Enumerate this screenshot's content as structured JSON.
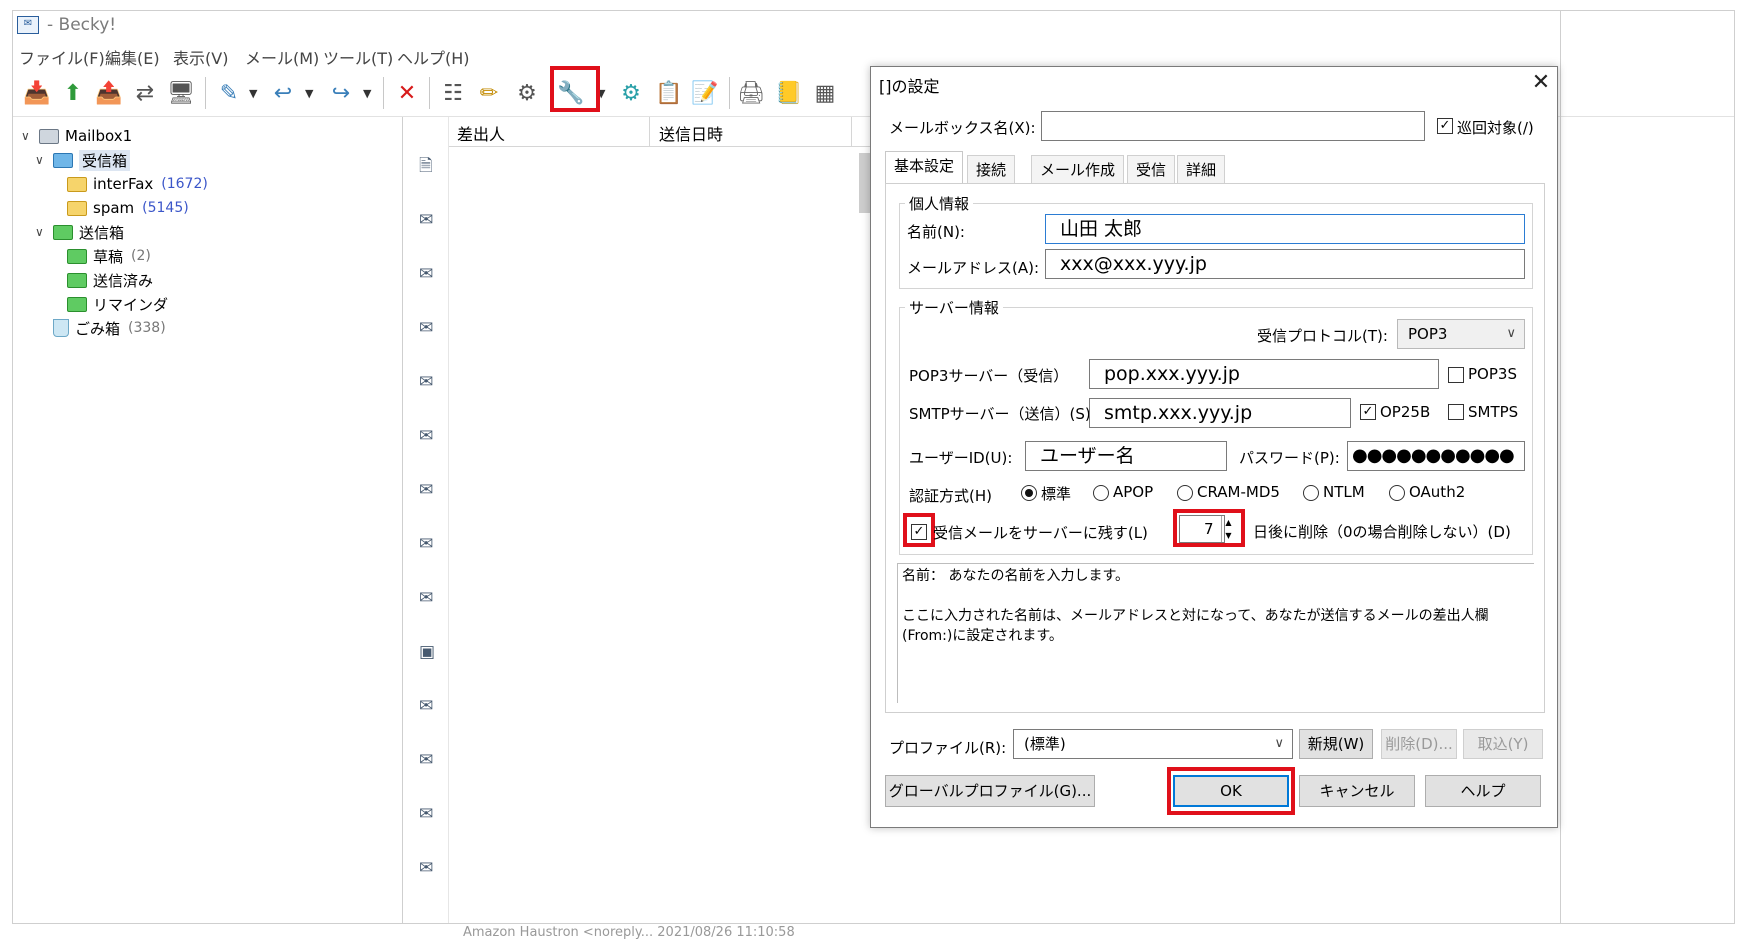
{
  "app": {
    "title": "- Becky!"
  },
  "menu": [
    "ファイル(F)",
    "編集(E)",
    "表示(V)",
    "メール(M)",
    "ツール(T)",
    "ヘルプ(H)"
  ],
  "folders": [
    {
      "label": "Mailbox1",
      "count": ""
    },
    {
      "label": "受信箱",
      "count": ""
    },
    {
      "label": "interFax",
      "count": "(1672)"
    },
    {
      "label": "spam",
      "count": "(5145)"
    },
    {
      "label": "送信箱",
      "count": ""
    },
    {
      "label": "草稿",
      "count": "(2)"
    },
    {
      "label": "送信済み",
      "count": ""
    },
    {
      "label": "リマインダ",
      "count": ""
    },
    {
      "label": "ごみ箱",
      "count": "(338)"
    }
  ],
  "list": {
    "col_sender": "差出人",
    "col_date": "送信日時",
    "bottom_text": "Amazon Haustron <noreply...  2021/08/26 11:10:58"
  },
  "dialog": {
    "title": "[]の設定",
    "mailbox_name_label": "メールボックス名(X):",
    "mailbox_name_value": "",
    "patrol_label": "巡回対象(/)",
    "tabs": [
      "基本設定",
      "接続",
      "メール作成",
      "受信",
      "詳細"
    ],
    "personal_group": "個人情報",
    "name_label": "名前(N):",
    "name_value": "山田 太郎",
    "email_label": "メールアドレス(A):",
    "email_value": "xxx@xxx.yyy.jp",
    "server_group": "サーバー情報",
    "protocol_label": "受信プロトコル(T):",
    "protocol_value": "POP3",
    "pop3_label": "POP3サーバー（受信）",
    "pop3_value": "pop.xxx.yyy.jp",
    "pop3s_label": "POP3S",
    "smtp_label": "SMTPサーバー（送信）(S):",
    "smtp_value": "smtp.xxx.yyy.jp",
    "op25b_label": "OP25B",
    "smtps_label": "SMTPS",
    "userid_label": "ユーザーID(U):",
    "userid_value": "ユーザー名",
    "password_label": "パスワード(P):",
    "password_value": "●●●●●●●●●●●",
    "auth_label": "認証方式(H)",
    "auth_options": [
      "標準",
      "APOP",
      "CRAM-MD5",
      "NTLM",
      "OAuth2"
    ],
    "keep_label": "受信メールをサーバーに残す(L)",
    "days_value": "7",
    "days_label": "日後に削除（0の場合削除しない）(D)",
    "help_line1": "名前：  あなたの名前を入力します。",
    "help_line2": "ここに入力された名前は、メールアドレスと対になって、あなたが送信するメールの差出人欄(From:)に設定されます。",
    "profile_label": "プロファイル(R):",
    "profile_value": "(標準)",
    "new_button": "新規(W)",
    "delete_button": "削除(D)...",
    "import_button": "取込(Y)",
    "global_profile_button": "グローバルプロファイル(G)...",
    "ok_button": "OK",
    "cancel_button": "キャンセル",
    "help_button": "ヘルプ"
  },
  "colors": {
    "highlight": "#e0101a",
    "accent": "#0078d7",
    "count": "#3b56c9"
  }
}
